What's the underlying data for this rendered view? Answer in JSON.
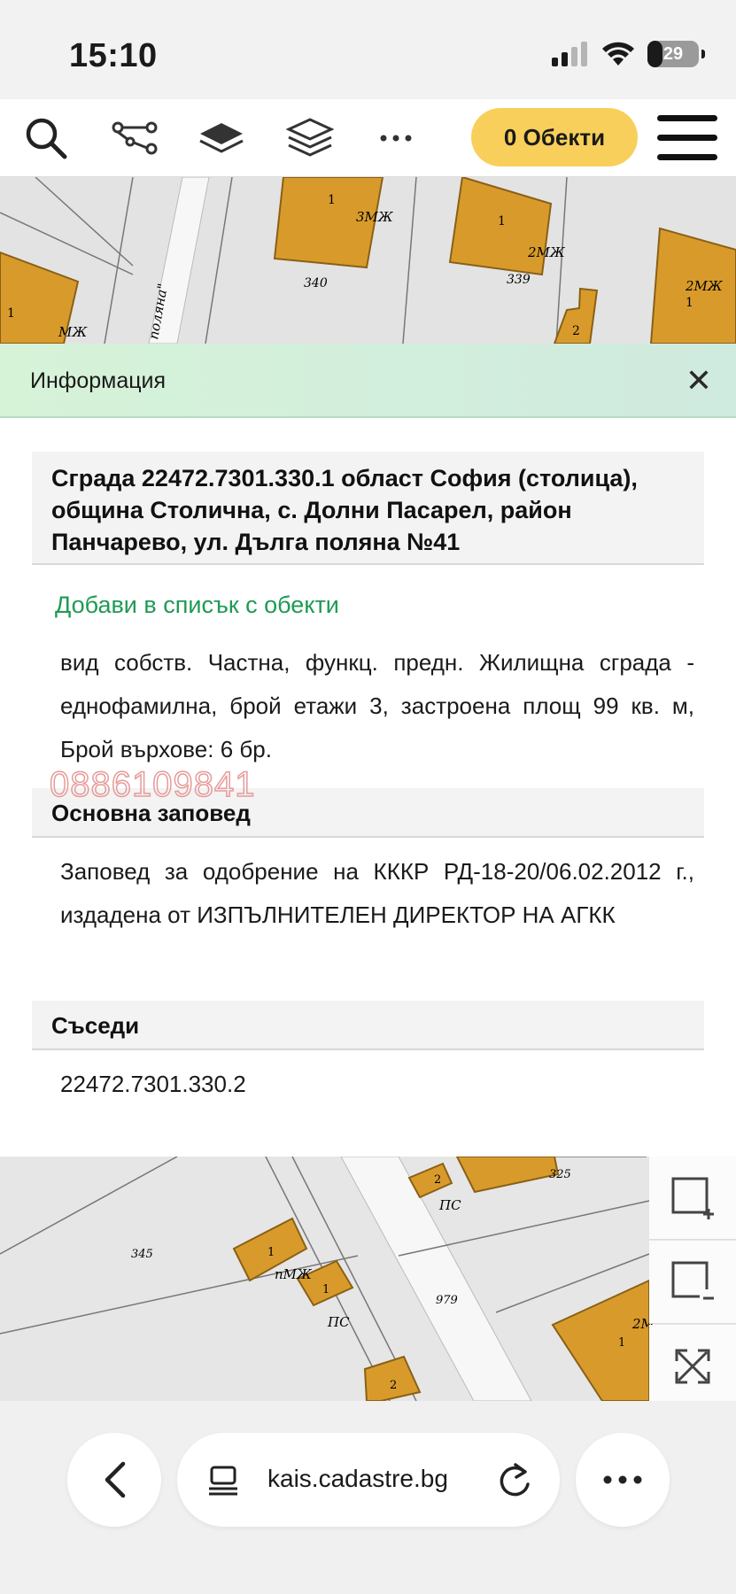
{
  "status_bar": {
    "time": "15:10",
    "battery": "29",
    "battery_level": 0.29
  },
  "toolbar": {
    "icons": [
      "search-icon",
      "route-icon",
      "layer-icon",
      "layers-stack-icon",
      "more-icon"
    ],
    "objects_label": "0 Обекти",
    "menu_icon": "hamburger-menu-icon"
  },
  "map_top": {
    "labels": [
      "1",
      "3МЖ",
      "340",
      "1",
      "2МЖ",
      "339",
      "1",
      "МЖ",
      "поляна\"",
      "2",
      "1",
      "2МЖ"
    ]
  },
  "info": {
    "header_title": "Информация",
    "close_label": "✕",
    "building_title": "Сграда 22472.7301.330.1 област София (столица), община Столична, с. Долни Пасарел, район Панчарево, ул. Дълга поляна №41",
    "add_link": "Добави в списък с обекти",
    "details": "вид собств. Частна, функц. предн. Жилищна сграда - еднофамилна, брой етажи 3, застроена площ 99 кв. м, Брой върхове: 6 бр.",
    "watermark": "0886109841",
    "order_heading": "Основна заповед",
    "order_text": "Заповед за одобрение на КККР РД-18-20/06.02.2012 г., издадена от ИЗПЪЛНИТЕЛЕН ДИРЕКТОР НА АГКК",
    "neighbors_heading": "Съседи",
    "neighbors_value": "22472.7301.330.2"
  },
  "map_bottom": {
    "labels": [
      "2",
      "ПС",
      "325",
      "345",
      "1",
      "пМЖ",
      "1",
      "ПС",
      "979",
      "2",
      "1",
      "2М"
    ]
  },
  "map_controls": [
    "select-area-add-icon",
    "select-area-remove-icon",
    "fullscreen-icon"
  ],
  "browser": {
    "url": "kais.cadastre.bg",
    "back_icon": "back-chevron-icon",
    "reader_icon": "reader-icon",
    "reload_icon": "reload-icon",
    "more_icon": "more-dots-icon"
  },
  "colors": {
    "building_fill": "#d89b2b",
    "building_stroke": "#8a6016",
    "objects_button": "#f8cf5a",
    "link_green": "#1f9a55",
    "header_green": "#d6f3d8",
    "watermark": "#e79a9a"
  }
}
